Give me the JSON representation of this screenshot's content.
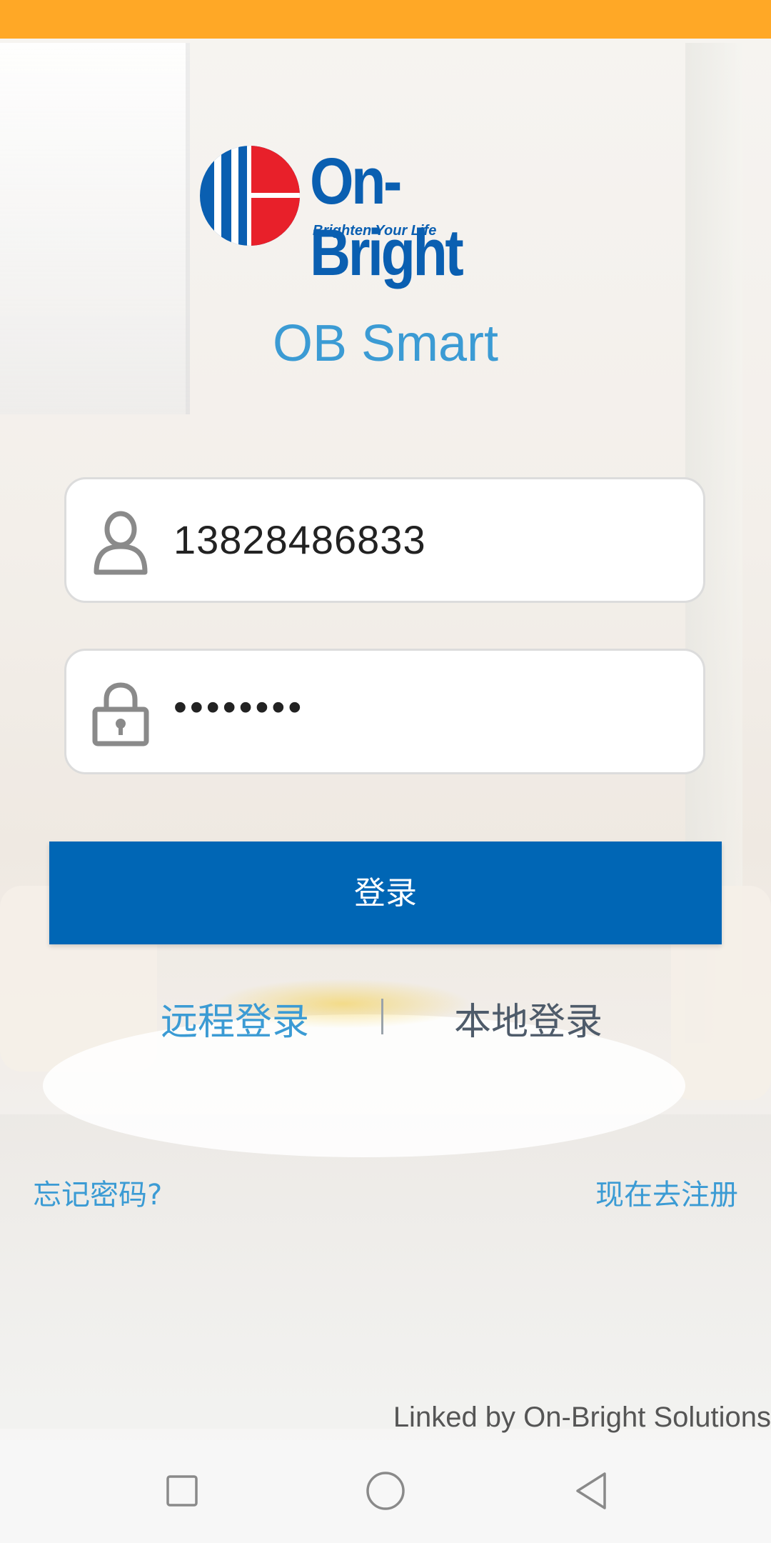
{
  "app": {
    "brand_name": "On-Bright",
    "brand_tagline": "Brighten Your Life",
    "title": "OB Smart"
  },
  "login_form": {
    "username_value": "13828486833",
    "password_value": "••••••••",
    "username_icon": "user-icon",
    "password_icon": "lock-icon",
    "submit_label": "登录"
  },
  "login_modes": {
    "remote_label": "远程登录",
    "local_label": "本地登录",
    "selected": "remote"
  },
  "links": {
    "forgot_password": "忘记密码?",
    "register": "现在去注册"
  },
  "footer": {
    "credit": "Linked by On-Bright Solutions"
  },
  "nav_bar": {
    "recent_icon": "square-icon",
    "home_icon": "circle-icon",
    "back_icon": "triangle-back-icon"
  },
  "colors": {
    "status_bar": "#ffa826",
    "brand_blue": "#0a5fb1",
    "brand_red": "#e8202a",
    "accent_blue": "#3b9bd4",
    "button_blue": "#0066b5"
  }
}
